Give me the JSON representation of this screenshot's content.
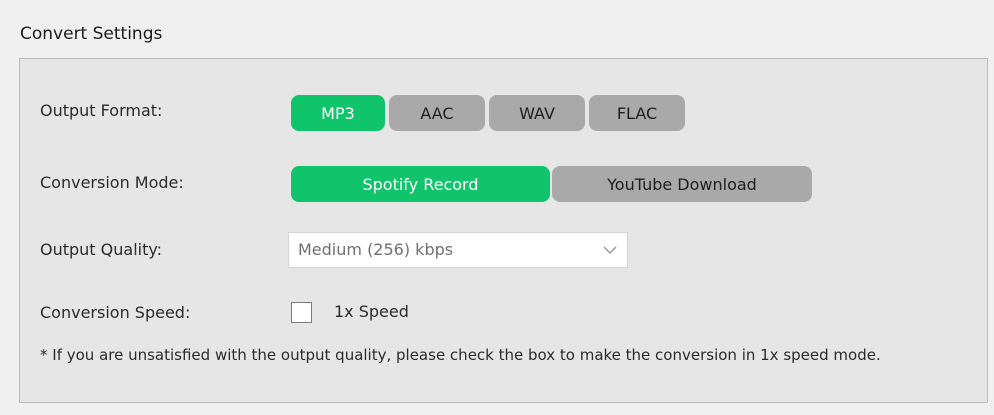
{
  "group": {
    "title": "Convert Settings"
  },
  "output_format": {
    "label": "Output Format:",
    "options": [
      "MP3",
      "AAC",
      "WAV",
      "FLAC"
    ],
    "selected": "MP3"
  },
  "conversion_mode": {
    "label": "Conversion Mode:",
    "options": [
      "Spotify Record",
      "YouTube Download"
    ],
    "selected": "Spotify Record"
  },
  "output_quality": {
    "label": "Output Quality:",
    "value": "Medium (256) kbps",
    "icon": "chevron-down-icon"
  },
  "conversion_speed": {
    "label": "Conversion Speed:",
    "checkbox_label": "1x Speed",
    "checked": false
  },
  "note": "* If you are unsatisfied with the output quality, please check the box to make the conversion in 1x speed mode.",
  "colors": {
    "accent": "#0fc46a",
    "inactive": "#a9a9a9",
    "panel": "#e6e6e6",
    "background": "#f0f0f0"
  }
}
